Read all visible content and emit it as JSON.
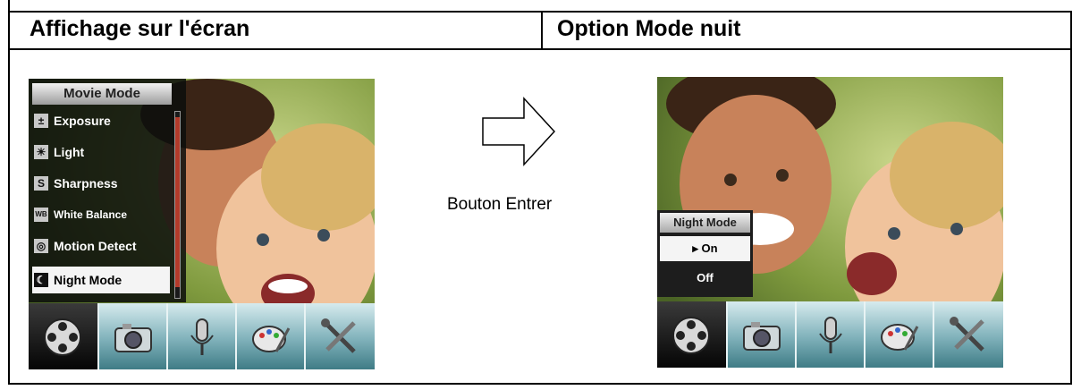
{
  "header": {
    "left_title": "Affichage sur l'écran",
    "right_title": "Option Mode nuit"
  },
  "left_screen": {
    "menu_title": "Movie Mode",
    "items": [
      {
        "label": "Exposure",
        "icon": "exposure-icon",
        "glyph": "±"
      },
      {
        "label": "Light",
        "icon": "light-icon",
        "glyph": "☀"
      },
      {
        "label": "Sharpness",
        "icon": "sharpness-icon",
        "glyph": "S"
      },
      {
        "label": "White Balance",
        "icon": "white-balance-icon",
        "glyph": "WB"
      },
      {
        "label": "Motion Detect",
        "icon": "motion-detect-icon",
        "glyph": "◎"
      },
      {
        "label": "Night Mode",
        "icon": "night-mode-icon",
        "glyph": "☾"
      }
    ],
    "selected_item": "Night Mode"
  },
  "right_screen": {
    "panel_title": "Night Mode",
    "options": [
      {
        "label": "▸ On",
        "selected": true
      },
      {
        "label": "Off",
        "selected": false
      }
    ]
  },
  "toolbar": [
    {
      "icon": "movie-reel-icon",
      "active": true
    },
    {
      "icon": "camera-icon",
      "active": false
    },
    {
      "icon": "microphone-icon",
      "active": false
    },
    {
      "icon": "palette-icon",
      "active": false
    },
    {
      "icon": "tools-icon",
      "active": false
    }
  ],
  "instruction": {
    "caption": "Bouton Entrer",
    "arrow_icon": "right-arrow-icon"
  },
  "colors": {
    "toolbar_teal": "#7fb1ba",
    "scrollbar_red": "#b33a2a",
    "menu_bg": "#0c0e0c"
  }
}
